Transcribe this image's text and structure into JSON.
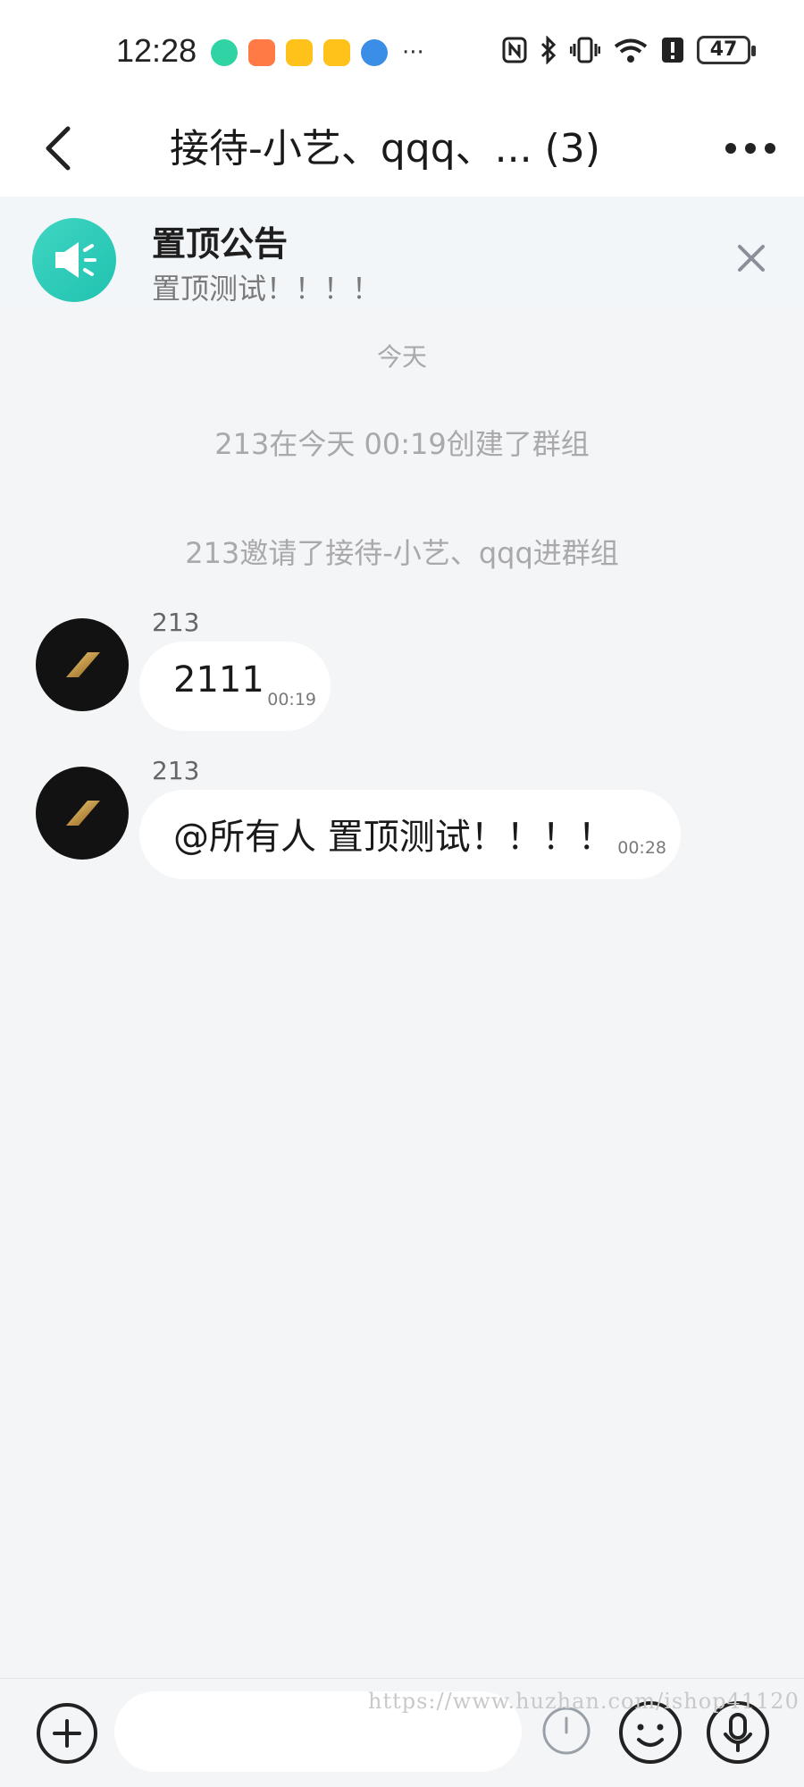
{
  "status_bar": {
    "time": "12:28",
    "more": "···",
    "battery": "47",
    "app_icons": [
      {
        "name": "chat-app-icon",
        "color": "#2fd3a4",
        "round": true
      },
      {
        "name": "heart-app-icon",
        "color": "#ff7a45",
        "round": false
      },
      {
        "name": "weibo-app-icon",
        "color": "#ffb400",
        "round": false
      },
      {
        "name": "weibo-app-icon-2",
        "color": "#ffb400",
        "round": false
      },
      {
        "name": "browser-app-icon",
        "color": "#3a8ee6",
        "round": true
      }
    ]
  },
  "header": {
    "title": "接待-小艺、qqq、... (3)"
  },
  "notice": {
    "title": "置顶公告",
    "body": "置顶测试！！！！"
  },
  "system_messages": {
    "date": "今天",
    "created": "213在今天 00:19创建了群组",
    "invited": "213邀请了接待-小艺、qqq进群组"
  },
  "messages": [
    {
      "sender": "213",
      "text": "2111",
      "time": "00:19"
    },
    {
      "sender": "213",
      "text": "@所有人 置顶测试！！！！",
      "time": "00:28"
    }
  ],
  "watermark": "https://www.huzhan.com/ishop41120",
  "input": {
    "placeholder": "",
    "value": ""
  }
}
